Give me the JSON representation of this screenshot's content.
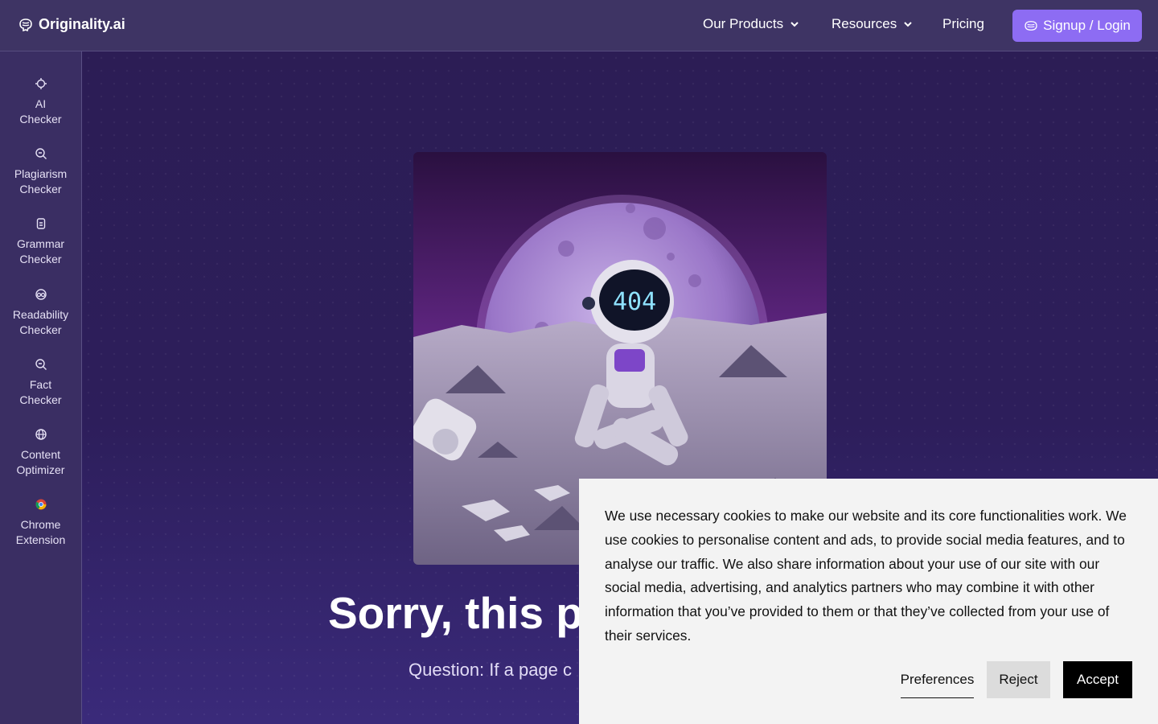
{
  "header": {
    "logo_text": "Originality.ai",
    "logo_icon": "brain-icon",
    "nav": {
      "products_label": "Our Products",
      "resources_label": "Resources",
      "pricing_label": "Pricing",
      "signup_label": "Signup / Login"
    }
  },
  "sidebar": {
    "items": [
      {
        "line1": "AI",
        "line2": "Checker",
        "icon": "chip-icon"
      },
      {
        "line1": "Plagiarism",
        "line2": "Checker",
        "icon": "search-icon"
      },
      {
        "line1": "Grammar",
        "line2": "Checker",
        "icon": "clipboard-icon"
      },
      {
        "line1": "Readability",
        "line2": "Checker",
        "icon": "glasses-icon"
      },
      {
        "line1": "Fact",
        "line2": "Checker",
        "icon": "magnify-icon"
      },
      {
        "line1": "Content",
        "line2": "Optimizer",
        "icon": "globe-icon"
      },
      {
        "line1": "Chrome",
        "line2": "Extension",
        "icon": "chrome-icon"
      }
    ]
  },
  "hero": {
    "image_text": "404",
    "title": "Sorry, this pa",
    "subtitle": "Question: If a page c"
  },
  "cookie": {
    "text": "We use necessary cookies to make our website and its core functionalities work. We use cookies to personalise content and ads, to provide social media features, and to analyse our traffic. We also share information about your use of our site with our social media, advertising, and analytics partners who may combine it with other information that you’ve provided to them or that they’ve collected from your use of their services.",
    "preferences_label": "Preferences",
    "reject_label": "Reject",
    "accept_label": "Accept"
  },
  "colors": {
    "header_bg": "#3e3464",
    "sidebar_bg": "#3a2e63",
    "main_bg": "#2c1d55",
    "accent": "#8d6cf3",
    "cookie_bg": "#f3f3f3"
  }
}
